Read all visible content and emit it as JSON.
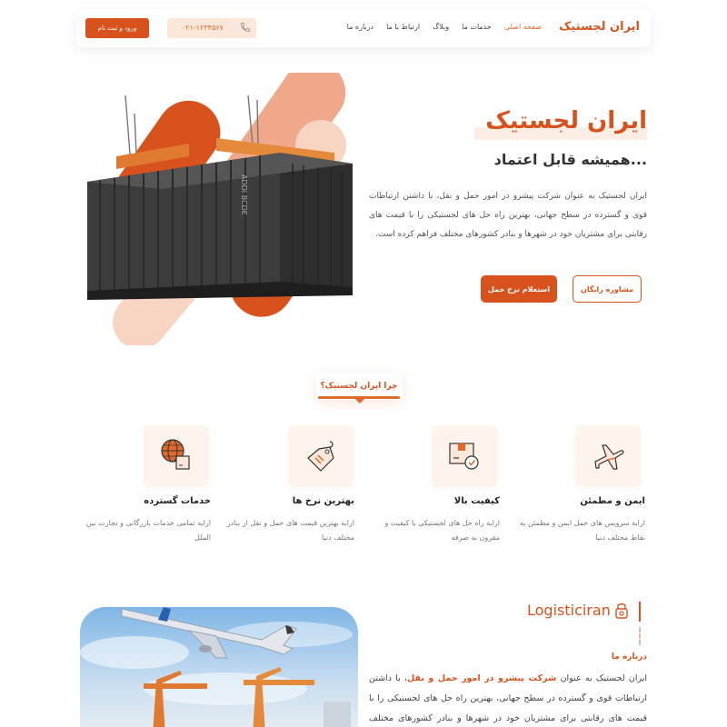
{
  "header": {
    "logo": "ایران لجستیک",
    "nav": [
      "صفحه اصلی",
      "خدمات ما",
      "وبلاگ",
      "ارتباط با ما",
      "درباره ما"
    ],
    "phone": "۰۲۱-۱۲۳۴۵۶۷",
    "login_label": "ورود و ثبت نام"
  },
  "hero": {
    "title": "ایران لجستیک",
    "subtitle": "همیشه قابل اعتماد...",
    "description": "ایران لجستیک به عنوان شرکت پیشرو در امور حمل و نقل، با داشتن ارتباطات قوی و گسترده در سطح جهانی، بهترین راه حل های لجستیکی را با قیمت های رقابتی برای مشتریان خود در شهرها و بنادر کشورهای مختلف فراهم کرده است.",
    "btn_consult": "مشاوره رایگان",
    "btn_quote": "استعلام نرخ حمل",
    "container_text": "ADDI BCDE"
  },
  "why": {
    "badge": "چرا ایران لجستیک؟"
  },
  "features": [
    {
      "icon": "airplane-icon",
      "title": "ایمن و مطمئن",
      "desc": "ارایه سرویس های حمل ایمن و مطمئن به نقاط مختلف دنیا"
    },
    {
      "icon": "package-check-icon",
      "title": "کیفیت بالا",
      "desc": "ارایه راه حل های لجستیکی با کیفیت و مقرون به صرفه"
    },
    {
      "icon": "price-tag-icon",
      "title": "بهترین نرخ ها",
      "desc": "ارایه بهترین قیمت های حمل و نقل از بنادر مختلف دنیا"
    },
    {
      "icon": "globe-box-icon",
      "title": "خدمات گسترده",
      "desc": "ارایه تمامی خدمات بازرگانی و تجارت بین الملل"
    }
  ],
  "about": {
    "brand": "Logisticiran",
    "label": "درباره ما",
    "desc_part1": "ایران لجستیک به عنوان ",
    "desc_highlight": "شرکت پیشرو در امور حمل و نقل",
    "desc_part2": "، با داشتن ارتباطات قوی و گسترده در سطح جهانی، بهترین راه حل های لجستیکی را با قیمت های رقابتی برای مشتریان خود در شهرها و بنادر کشورهای مختلف فراهم کرده"
  },
  "colors": {
    "accent": "#d8521d",
    "accent_light": "#fbe6da",
    "peach": "#f2b79a"
  }
}
